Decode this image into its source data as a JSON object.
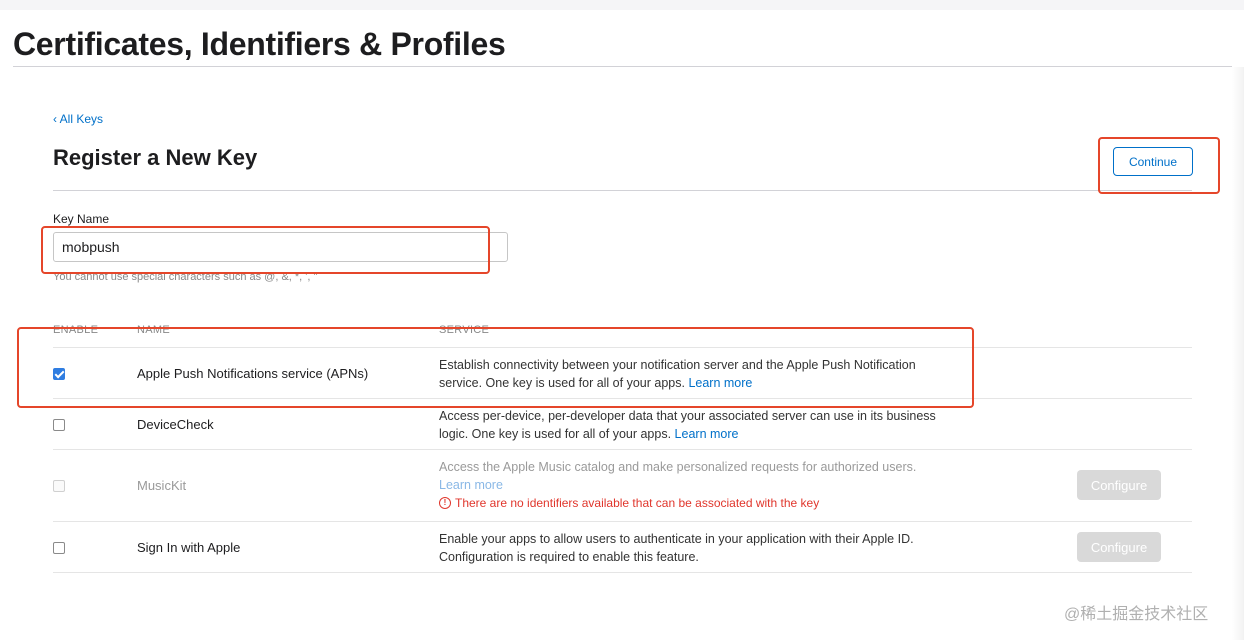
{
  "page": {
    "title": "Certificates, Identifiers & Profiles"
  },
  "nav": {
    "back_label": "‹ All Keys"
  },
  "form": {
    "heading": "Register a New Key",
    "continue_label": "Continue",
    "key_name_label": "Key Name",
    "key_name_value": "mobpush",
    "key_name_hint": "You cannot use special characters such as @, &, *, ', \""
  },
  "table": {
    "columns": [
      "ENABLE",
      "NAME",
      "SERVICE"
    ],
    "rows": [
      {
        "name": "Apple Push Notifications service (APNs)",
        "description": "Establish connectivity between your notification server and the Apple Push Notification service. One key is used for all of your apps.",
        "link": "Learn more",
        "checked": true,
        "disabled": false
      },
      {
        "name": "DeviceCheck",
        "description": "Access per-device, per-developer data that your associated server can use in its business logic. One key is used for all of your apps.",
        "link": "Learn more",
        "checked": false,
        "disabled": false
      },
      {
        "name": "MusicKit",
        "description": "Access the Apple Music catalog and make personalized requests for authorized users.",
        "link": "Learn more",
        "warning": "There are no identifiers available that can be associated with the key",
        "checked": false,
        "disabled": true,
        "button": "Configure"
      },
      {
        "name": "Sign In with Apple",
        "description": "Enable your apps to allow users to authenticate in your application with their Apple ID. Configuration is required to enable this feature.",
        "checked": false,
        "disabled": false,
        "button": "Configure"
      }
    ]
  },
  "watermark": "@稀土掘金技术社区",
  "colors": {
    "accent": "#0070c9",
    "highlight": "#e5462a",
    "warning": "#e0362c",
    "checkbox": "#2f7de1"
  }
}
